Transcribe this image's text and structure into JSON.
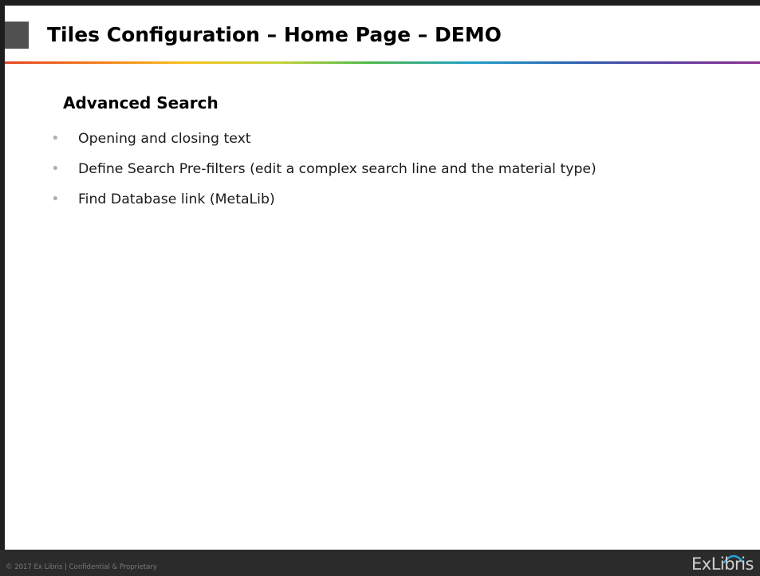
{
  "slide": {
    "title": "Tiles Configuration – Home Page – DEMO",
    "section_heading": "Advanced Search",
    "bullets": [
      "Opening and closing text",
      "Define Search Pre-filters (edit a complex search line and the material type)",
      "Find Database link (MetaLib)"
    ],
    "bullet_symbol": "•"
  },
  "footer": {
    "copyright": "© 2017 Ex Libris | Confidential & Proprietary",
    "logo_text": "ExLibris",
    "logo_icon": "exlibris-logo-icon"
  },
  "colors": {
    "frame": "#1e1e1e",
    "title_marker": "#505050",
    "footer_bg": "#2b2b2b",
    "footer_text": "#7a7a7a",
    "bullet": "#b0b0b0",
    "logo_arc": "#2a9fd6"
  }
}
